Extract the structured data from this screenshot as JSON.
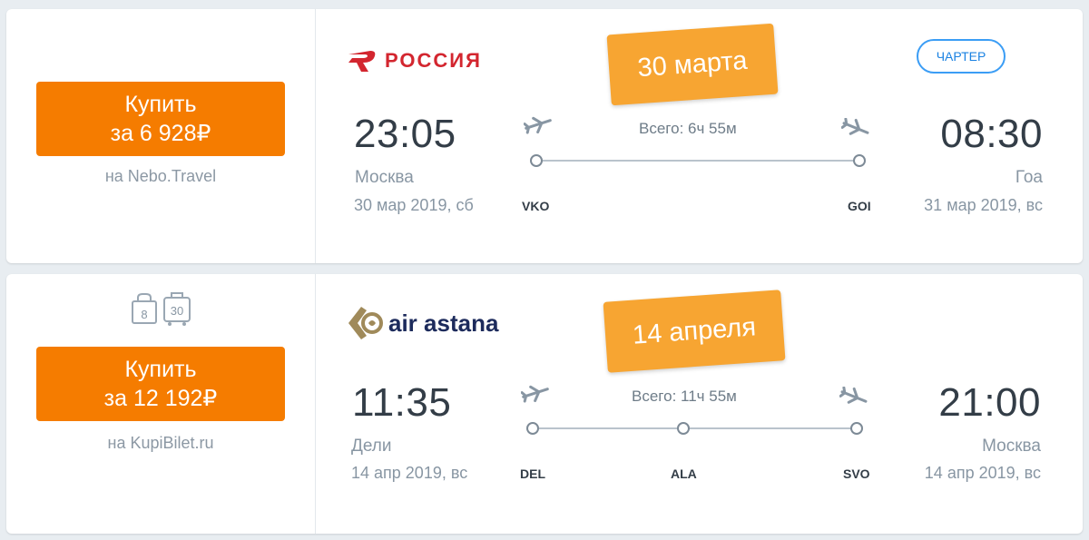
{
  "colors": {
    "buy_button": "#f57c00",
    "date_badge": "#f7a532",
    "charter_border": "#3b9df5",
    "russia_red": "#d3262f",
    "air_astana_navy": "#1d2b5c",
    "air_astana_gold": "#a08a5a"
  },
  "flights": [
    {
      "buy": {
        "label": "Купить",
        "price": "за 6 928₽"
      },
      "vendor": "на Nebo.Travel",
      "airline": "РОССИЯ",
      "date_badge": "30 марта",
      "charter_badge": "ЧАРТЕР",
      "total_duration": "Всего: 6ч 55м",
      "departure": {
        "time": "23:05",
        "city": "Москва",
        "date": "30 мар 2019, сб",
        "code": "VKO"
      },
      "arrival": {
        "time": "08:30",
        "city": "Гоа",
        "date": "31 мар 2019, вс",
        "code": "GOI"
      },
      "icons": [
        "takeoff-icon",
        "landing-icon"
      ]
    },
    {
      "buy": {
        "label": "Купить",
        "price": "за 12 192₽"
      },
      "vendor": "на KupiBilet.ru",
      "baggage": {
        "handbag": "8",
        "luggage": "30"
      },
      "airline": "air astana",
      "date_badge": "14 апреля",
      "total_duration": "Всего: 11ч 55м",
      "departure": {
        "time": "11:35",
        "city": "Дели",
        "date": "14 апр 2019, вс",
        "code": "DEL"
      },
      "stop": {
        "code": "ALA"
      },
      "arrival": {
        "time": "21:00",
        "city": "Москва",
        "date": "14 апр 2019, вс",
        "code": "SVO"
      },
      "icons": [
        "takeoff-icon",
        "landing-icon"
      ]
    }
  ]
}
